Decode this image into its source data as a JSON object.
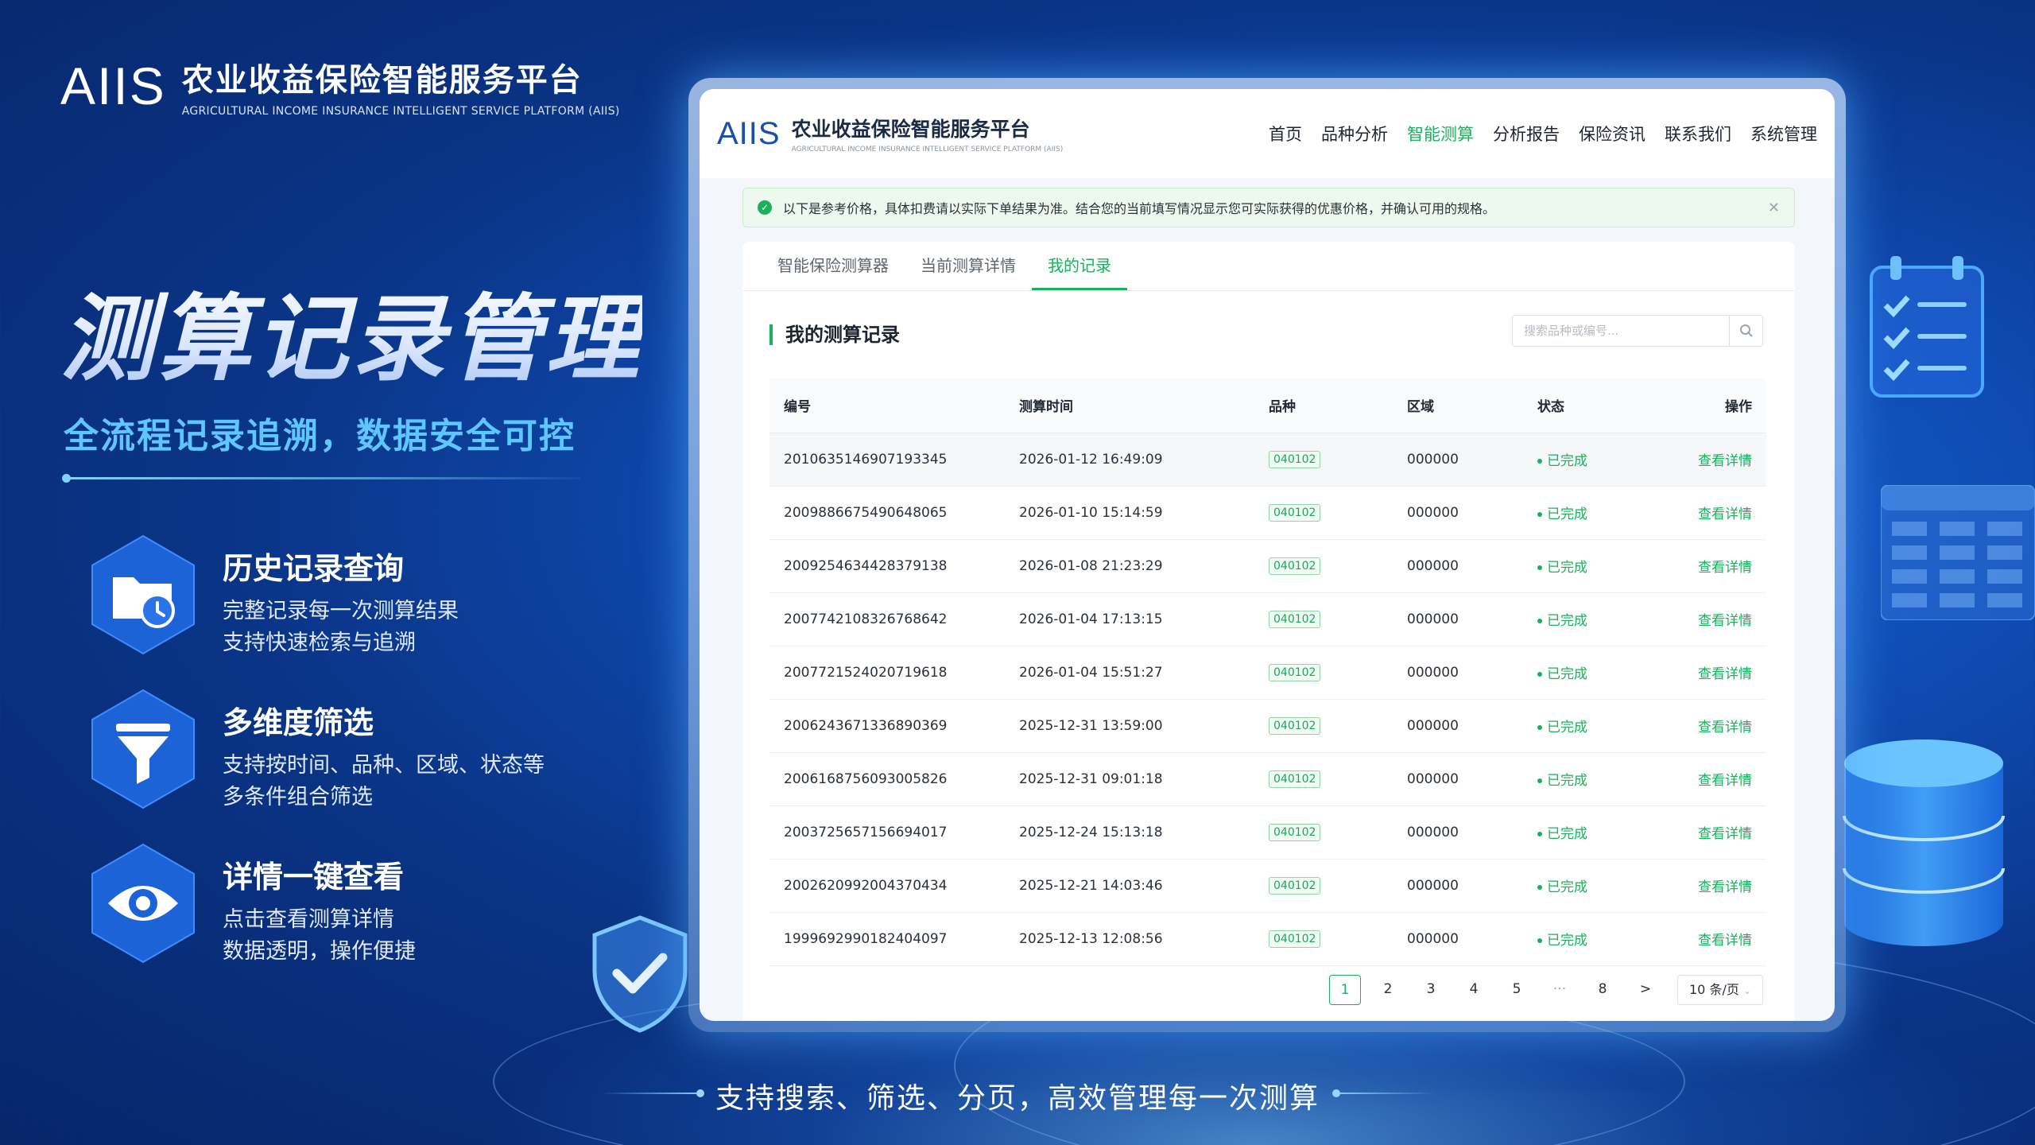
{
  "brand": {
    "logo": "AIIS",
    "title": "农业收益保险智能服务平台",
    "subtitle": "AGRICULTURAL INCOME INSURANCE INTELLIGENT SERVICE PLATFORM (AIIS)"
  },
  "hero": {
    "title": "测算记录管理",
    "subtitle": "全流程记录追溯，数据安全可控"
  },
  "features": [
    {
      "icon": "folder-clock-icon",
      "title": "历史记录查询",
      "line1": "完整记录每一次测算结果",
      "line2": "支持快速检索与追溯"
    },
    {
      "icon": "funnel-icon",
      "title": "多维度筛选",
      "line1": "支持按时间、品种、区域、状态等",
      "line2": "多条件组合筛选"
    },
    {
      "icon": "eye-icon",
      "title": "详情一键查看",
      "line1": "点击查看测算详情",
      "line2": "数据透明，操作便捷"
    }
  ],
  "bottom_caption": "支持搜索、筛选、分页，高效管理每一次测算",
  "app": {
    "logo": "AIIS",
    "title": "农业收益保险智能服务平台",
    "subtitle": "AGRICULTURAL INCOME INSURANCE INTELLIGENT SERVICE PLATFORM (AIIS)",
    "nav": [
      "首页",
      "品种分析",
      "智能测算",
      "分析报告",
      "保险资讯",
      "联系我们",
      "系统管理"
    ],
    "nav_active": "智能测算",
    "notice": "以下是参考价格，具体扣费请以实际下单结果为准。结合您的当前填写情况显示您可实际获得的优惠价格，并确认可用的规格。",
    "tabs": [
      "智能保险测算器",
      "当前测算详情",
      "我的记录"
    ],
    "tab_active": "我的记录",
    "section_title": "我的测算记录",
    "search_placeholder": "搜索品种或编号...",
    "columns": [
      "编号",
      "测算时间",
      "品种",
      "区域",
      "状态",
      "操作"
    ],
    "rows": [
      {
        "id": "2010635146907193345",
        "time": "2026-01-12 16:49:09",
        "variety": "040102",
        "region": "000000",
        "status": "已完成",
        "action": "查看详情"
      },
      {
        "id": "2009886675490648065",
        "time": "2026-01-10 15:14:59",
        "variety": "040102",
        "region": "000000",
        "status": "已完成",
        "action": "查看详情"
      },
      {
        "id": "2009254634428379138",
        "time": "2026-01-08 21:23:29",
        "variety": "040102",
        "region": "000000",
        "status": "已完成",
        "action": "查看详情"
      },
      {
        "id": "2007742108326768642",
        "time": "2026-01-04 17:13:15",
        "variety": "040102",
        "region": "000000",
        "status": "已完成",
        "action": "查看详情"
      },
      {
        "id": "2007721524020719618",
        "time": "2026-01-04 15:51:27",
        "variety": "040102",
        "region": "000000",
        "status": "已完成",
        "action": "查看详情"
      },
      {
        "id": "2006243671336890369",
        "time": "2025-12-31 13:59:00",
        "variety": "040102",
        "region": "000000",
        "status": "已完成",
        "action": "查看详情"
      },
      {
        "id": "2006168756093005826",
        "time": "2025-12-31 09:01:18",
        "variety": "040102",
        "region": "000000",
        "status": "已完成",
        "action": "查看详情"
      },
      {
        "id": "2003725657156694017",
        "time": "2025-12-24 15:13:18",
        "variety": "040102",
        "region": "000000",
        "status": "已完成",
        "action": "查看详情"
      },
      {
        "id": "2002620992004370434",
        "time": "2025-12-21 14:03:46",
        "variety": "040102",
        "region": "000000",
        "status": "已完成",
        "action": "查看详情"
      },
      {
        "id": "1999692990182404097",
        "time": "2025-12-13 12:08:56",
        "variety": "040102",
        "region": "000000",
        "status": "已完成",
        "action": "查看详情"
      }
    ],
    "pagination": {
      "pages": [
        "1",
        "2",
        "3",
        "4",
        "5",
        "···",
        "8"
      ],
      "current": "1",
      "next": ">",
      "page_size": "10 条/页"
    }
  },
  "colors": {
    "accent_green": "#16b35c",
    "hero_blue": "#5ec7ff",
    "bg_blue": "#0f4cb4"
  }
}
